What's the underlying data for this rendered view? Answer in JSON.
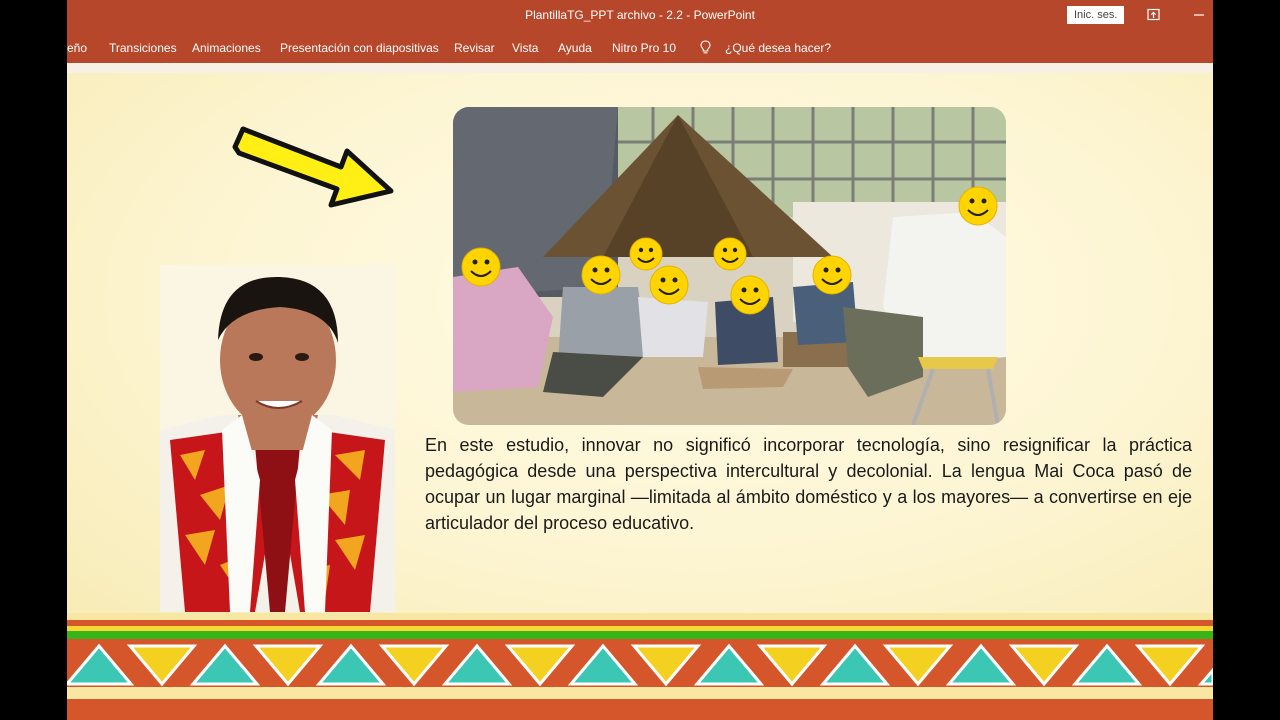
{
  "window": {
    "title": "PlantillaTG_PPT archivo - 2.2  -  PowerPoint",
    "signin_label": "Inic. ses."
  },
  "menu": {
    "items": [
      "eño",
      "Transiciones",
      "Animaciones",
      "Presentación con diapositivas",
      "Revisar",
      "Vista",
      "Ayuda",
      "Nitro Pro 10"
    ],
    "tell_me": "¿Qué desea hacer?"
  },
  "slide": {
    "paragraph": "En este estudio, innovar no significó incorporar tecnología, sino resignificar la práctica pedagógica desde una perspectiva intercultural y decolonial. La lengua Mai Coca pasó de ocupar un lugar marginal —limitada al ámbito doméstico y a los mayores— a convertirse en eje articulador del proceso educativo."
  },
  "colors": {
    "ribbon": "#b7472a",
    "arrow_fill": "#ffef14",
    "border_orange": "#d4562a",
    "border_green": "#37b418",
    "triangle_teal": "#3cc6b4",
    "triangle_yellow": "#f4d020"
  },
  "icons": {
    "share": "share-icon",
    "minimize": "minimize-icon",
    "tell_me": "lightbulb-icon"
  }
}
